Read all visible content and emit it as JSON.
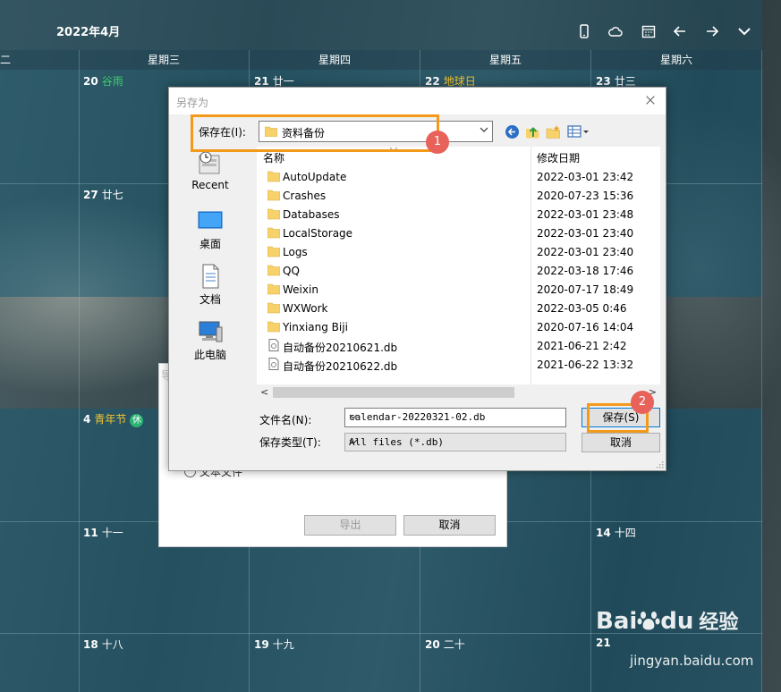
{
  "calendar": {
    "title": "2022年4月",
    "weekdays": [
      "二",
      "星期三",
      "星期四",
      "星期五",
      "星期六"
    ],
    "dates": [
      {
        "num": "20",
        "lunar": "谷雨"
      },
      {
        "num": "21",
        "lunar": "廿一"
      },
      {
        "num": "22",
        "lunar": "地球日"
      },
      {
        "num": "23",
        "lunar": "廿三"
      },
      {
        "num": "27",
        "lunar": "廿七"
      },
      {
        "num": "4",
        "lunar": "青年节",
        "badge": "休"
      },
      {
        "num": "11",
        "lunar": "十一"
      },
      {
        "num": "14",
        "lunar": "十四"
      },
      {
        "num": "18",
        "lunar": "十八"
      },
      {
        "num": "19",
        "lunar": "十九"
      },
      {
        "num": "20",
        "lunar": "二十"
      },
      {
        "num": "21",
        "lunar": ""
      }
    ]
  },
  "export_dialog": {
    "radio_label": "文本文件",
    "export_label": "导出",
    "cancel_label": "取消",
    "title_fragment": "导"
  },
  "save_dialog": {
    "title": "另存为",
    "save_in_label": "保存在(I):",
    "save_in_value": "资料备份",
    "places": [
      {
        "label": "Recent"
      },
      {
        "label": "桌面"
      },
      {
        "label": "文档"
      },
      {
        "label": "此电脑"
      }
    ],
    "columns": {
      "name": "名称",
      "date": "修改日期"
    },
    "files": [
      {
        "name": "AutoUpdate",
        "date": "2022-03-01 23:42",
        "kind": "folder"
      },
      {
        "name": "Crashes",
        "date": "2020-07-23 15:36",
        "kind": "folder"
      },
      {
        "name": "Databases",
        "date": "2022-03-01 23:48",
        "kind": "folder"
      },
      {
        "name": "LocalStorage",
        "date": "2022-03-01 23:40",
        "kind": "folder"
      },
      {
        "name": "Logs",
        "date": "2022-03-01 23:40",
        "kind": "folder"
      },
      {
        "name": "QQ",
        "date": "2022-03-18 17:46",
        "kind": "folder"
      },
      {
        "name": "Weixin",
        "date": "2020-07-17 18:49",
        "kind": "folder"
      },
      {
        "name": "WXWork",
        "date": "2022-03-05 0:46",
        "kind": "folder"
      },
      {
        "name": "Yinxiang Biji",
        "date": "2020-07-16 14:04",
        "kind": "folder"
      },
      {
        "name": "自动备份20210621.db",
        "date": "2021-06-21 2:42",
        "kind": "file"
      },
      {
        "name": "自动备份20210622.db",
        "date": "2021-06-22 13:32",
        "kind": "file"
      }
    ],
    "filename_label": "文件名(N):",
    "filename_value": "calendar-20220321-02.db",
    "filetype_label": "保存类型(T):",
    "filetype_value": "All files (*.db)",
    "save_label": "保存(S)",
    "cancel_label": "取消"
  },
  "annotations": {
    "badge1": "1",
    "badge2": "2",
    "color": "#f39a1a"
  },
  "watermark": {
    "brand": "Bai",
    "brand2": "du",
    "cn": "经验",
    "url": "jingyan.baidu.com"
  }
}
